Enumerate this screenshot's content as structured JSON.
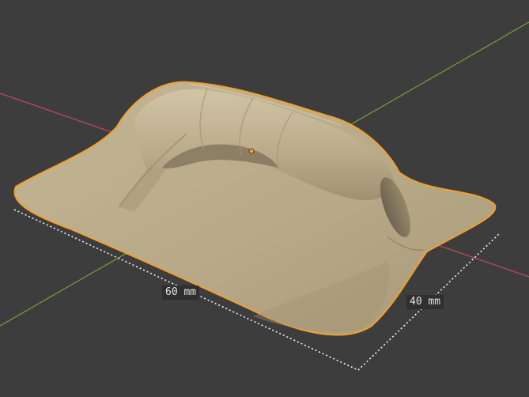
{
  "viewport": {
    "background_color": "#3d3d3d",
    "x_axis_color": "#b44a5c",
    "y_axis_color": "#6e9a3a",
    "selection_outline_color": "#f0a030",
    "mesh_color": "#bfb091",
    "origin_dot_color": "#f0a030"
  },
  "measurements": {
    "length_label": "60 mm",
    "width_label": "40 mm"
  }
}
